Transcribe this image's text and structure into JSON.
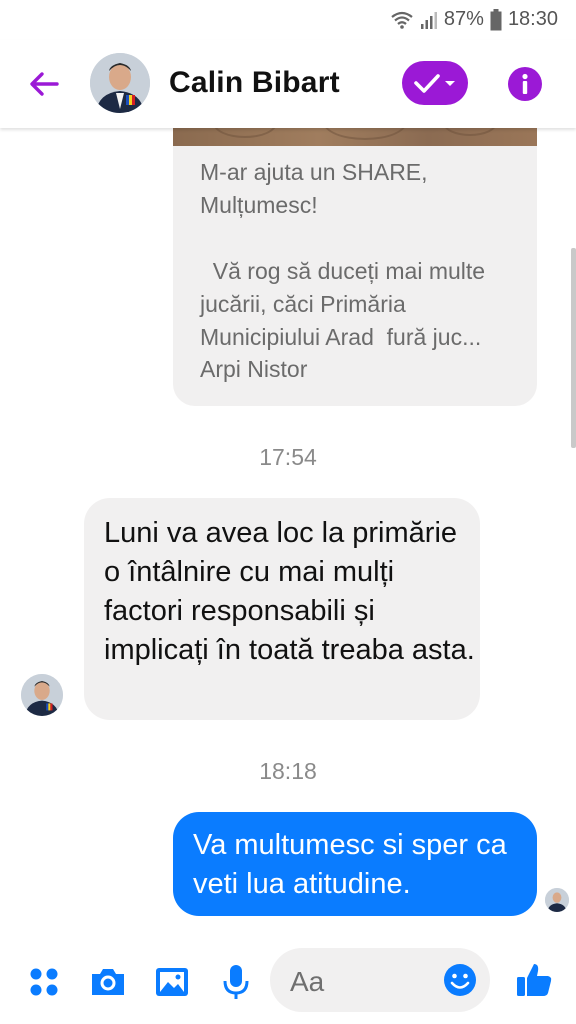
{
  "status_bar": {
    "battery": "87%",
    "time": "18:30"
  },
  "header": {
    "contact_name": "Calin Bibart"
  },
  "conversation": {
    "shared_post": {
      "text": "M-ar ajuta un SHARE,\nMulțumesc!\n\n  Vă rog să duceți mai multe jucării, căci Primăria Municipiului Arad  fură juc...",
      "source": "Arpi Nistor"
    },
    "timestamp_1": "17:54",
    "incoming_message": "Luni va avea loc la primărie o întâlnire cu mai mulți factori responsabili și implicați în toată treaba asta.",
    "timestamp_2": "18:18",
    "outgoing_message": "Va multumesc si sper ca veti lua atitudine."
  },
  "composer": {
    "placeholder": "Aa"
  },
  "colors": {
    "accent_purple": "#9b19d6",
    "outgoing_bubble": "#0a7cff",
    "incoming_bubble": "#f1f0f0",
    "icon_blue": "#0a7cff"
  },
  "icons": [
    "back-arrow-icon",
    "check-dropdown-icon",
    "info-icon",
    "more-dots-icon",
    "camera-icon",
    "gallery-icon",
    "microphone-icon",
    "emoji-icon",
    "thumbs-up-icon",
    "wifi-icon",
    "signal-icon",
    "battery-icon"
  ]
}
